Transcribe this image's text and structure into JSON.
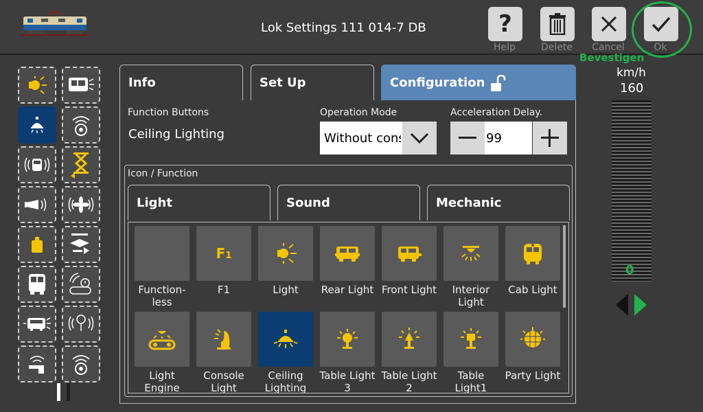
{
  "header": {
    "title": "Lok Settings 111 014-7 DB",
    "buttons": [
      {
        "label": "Help",
        "icon": "question-icon"
      },
      {
        "label": "Delete",
        "icon": "trash-icon"
      },
      {
        "label": "Cancel",
        "icon": "close-icon"
      },
      {
        "label": "Ok",
        "icon": "check-icon"
      }
    ],
    "annotation": "Bevestigen",
    "annotation_color": "#22b14c"
  },
  "tabs": [
    {
      "label": "Info"
    },
    {
      "label": "Set Up"
    },
    {
      "label": "Configuration",
      "icon": "unlock-icon",
      "active": true
    }
  ],
  "config": {
    "function_buttons_label": "Function Buttons",
    "function_buttons_value": "Ceiling Lighting",
    "operation_mode_label": "Operation Mode",
    "operation_mode_value": "Without cons",
    "accel_label": "Acceleration Delay.",
    "accel_value": "99",
    "icon_function_label": "Icon / Function"
  },
  "subtabs": [
    {
      "label": "Light"
    },
    {
      "label": "Sound"
    },
    {
      "label": "Mechanic"
    }
  ],
  "grid": [
    {
      "caption": "Function-\nless",
      "icon": "none"
    },
    {
      "caption": "F1",
      "icon": "f1-icon"
    },
    {
      "caption": "Light",
      "icon": "light-icon"
    },
    {
      "caption": "Rear Light",
      "icon": "rear-light-icon"
    },
    {
      "caption": "Front Light",
      "icon": "front-light-icon"
    },
    {
      "caption": "Interior\nLight",
      "icon": "interior-light-icon"
    },
    {
      "caption": "Cab Light",
      "icon": "cab-light-icon"
    },
    {
      "caption": "Light\nEngine",
      "icon": "light-engine-icon"
    },
    {
      "caption": "Console\nLight",
      "icon": "console-light-icon"
    },
    {
      "caption": "Ceiling\nLighting",
      "icon": "ceiling-lighting-icon",
      "selected": true
    },
    {
      "caption": "Table Light\n3",
      "icon": "table-light-3-icon"
    },
    {
      "caption": "Table Light\n2",
      "icon": "table-light-2-icon"
    },
    {
      "caption": "Table\nLight1",
      "icon": "table-light-1-icon"
    },
    {
      "caption": "Party Light",
      "icon": "party-light-icon"
    }
  ],
  "speed": {
    "unit": "km/h",
    "max": "160",
    "current": "0",
    "accent": "#22b14c"
  },
  "colors": {
    "accent_blue": "#5b86b8",
    "selected": "#0b3c72",
    "icon_yellow": "#f5c400"
  }
}
